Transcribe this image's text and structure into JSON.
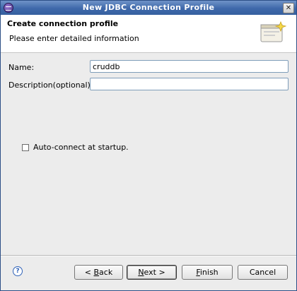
{
  "window": {
    "title": "New JDBC Connection Profile",
    "close_glyph": "✕"
  },
  "banner": {
    "title": "Create connection profile",
    "subtitle": "Please enter detailed information"
  },
  "form": {
    "name_label": "Name:",
    "name_value": "cruddb",
    "description_label": "Description(optional):",
    "description_value": "",
    "autoconnect_label": "Auto-connect at startup.",
    "autoconnect_checked": false
  },
  "footer": {
    "help_glyph": "?",
    "back": {
      "mnemonic": "B",
      "prefix": "< ",
      "rest": "ack"
    },
    "next": {
      "mnemonic": "N",
      "rest": "ext >"
    },
    "finish": {
      "mnemonic": "F",
      "rest": "inish"
    },
    "cancel_label": "Cancel"
  },
  "colors": {
    "titlebar": "#3f68aa",
    "banner_bg": "#ffffff",
    "dialog_bg": "#ececec",
    "field_border": "#7f9db9"
  }
}
